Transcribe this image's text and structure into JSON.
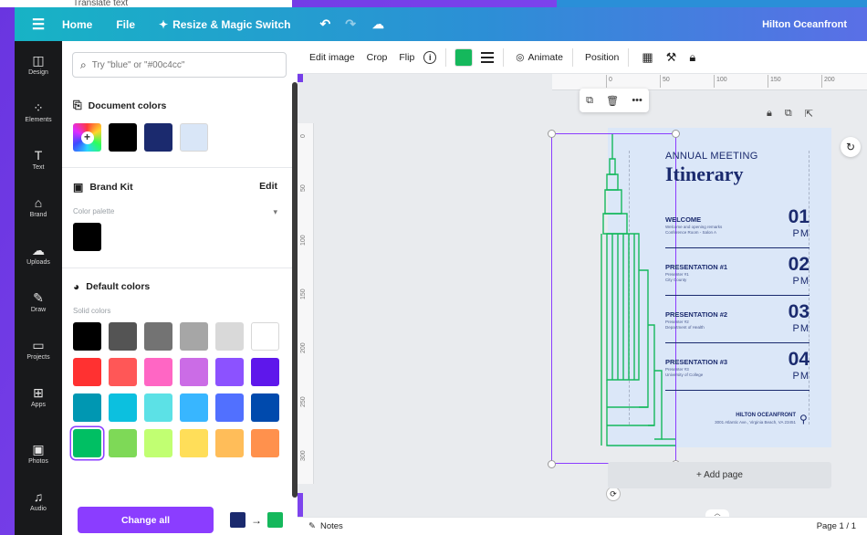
{
  "background": {
    "ghost_menu": "Translate text"
  },
  "topbar": {
    "home": "Home",
    "file": "File",
    "resize": "Resize & Magic Switch",
    "design_title": "Hilton Oceanfront"
  },
  "rail": {
    "items": [
      {
        "icon": "design-icon",
        "label": "Design"
      },
      {
        "icon": "elements-icon",
        "label": "Elements"
      },
      {
        "icon": "text-icon",
        "label": "Text"
      },
      {
        "icon": "brand-icon",
        "label": "Brand"
      },
      {
        "icon": "uploads-icon",
        "label": "Uploads"
      },
      {
        "icon": "draw-icon",
        "label": "Draw"
      },
      {
        "icon": "projects-icon",
        "label": "Projects"
      },
      {
        "icon": "apps-icon",
        "label": "Apps"
      },
      {
        "icon": "photos-icon",
        "label": "Photos"
      },
      {
        "icon": "audio-icon",
        "label": "Audio"
      }
    ]
  },
  "panel": {
    "search_placeholder": "Try \"blue\" or \"#00c4cc\"",
    "document_colors": {
      "title": "Document colors",
      "swatches": [
        "#000000",
        "#1b2a6e",
        "#d9e6f7"
      ]
    },
    "brand_kit": {
      "title": "Brand Kit",
      "edit_label": "Edit",
      "palette_label": "Color palette",
      "swatches": [
        "#000000"
      ]
    },
    "default_colors": {
      "title": "Default colors",
      "solid_label": "Solid colors",
      "rows": [
        [
          "#000000",
          "#545454",
          "#737373",
          "#a6a6a6",
          "#d9d9d9",
          "#ffffff"
        ],
        [
          "#ff3131",
          "#ff5757",
          "#ff66c4",
          "#cb6ce6",
          "#8c52ff",
          "#5e17eb"
        ],
        [
          "#0097b2",
          "#0cc0df",
          "#5ce1e6",
          "#38b6ff",
          "#5170ff",
          "#004aad"
        ],
        [
          "#00bf63",
          "#7ed957",
          "#c1ff72",
          "#ffde59",
          "#ffbd59",
          "#ff914d"
        ]
      ],
      "selected": "#00bf63"
    },
    "change_all_label": "Change all",
    "swap_from": "#1b2a6e",
    "swap_to": "#15b85c"
  },
  "toolbar": {
    "edit_image": "Edit image",
    "crop": "Crop",
    "flip": "Flip",
    "info": "i",
    "color": "#15b85c",
    "animate": "Animate",
    "position": "Position"
  },
  "rulers": {
    "top": [
      "0",
      "50",
      "100",
      "150",
      "200"
    ],
    "left": [
      "0",
      "50",
      "100",
      "150",
      "200",
      "250",
      "300"
    ]
  },
  "doc": {
    "eyebrow": "ANNUAL MEETING",
    "title": "Itinerary",
    "agenda": [
      {
        "heading": "WELCOME",
        "line1": "Welcome and opening remarks",
        "line2": "Conference Room - Salon A",
        "num": "01",
        "pm": "PM"
      },
      {
        "heading": "PRESENTATION #1",
        "line1": "Presenter #1",
        "line2": "City County",
        "num": "02",
        "pm": "PM"
      },
      {
        "heading": "PRESENTATION #2",
        "line1": "Presenter #2",
        "line2": "Department of Health",
        "num": "03",
        "pm": "PM"
      },
      {
        "heading": "PRESENTATION #3",
        "line1": "Presenter #3",
        "line2": "University of College",
        "num": "04",
        "pm": "PM"
      }
    ],
    "venue": "HILTON OCEANFRONT",
    "address": "3001 Atlantic Ave., Virginia Beach, VA 23451"
  },
  "add_page_label": "+ Add page",
  "bottombar": {
    "notes": "Notes",
    "page_count": "Page 1 / 1"
  }
}
